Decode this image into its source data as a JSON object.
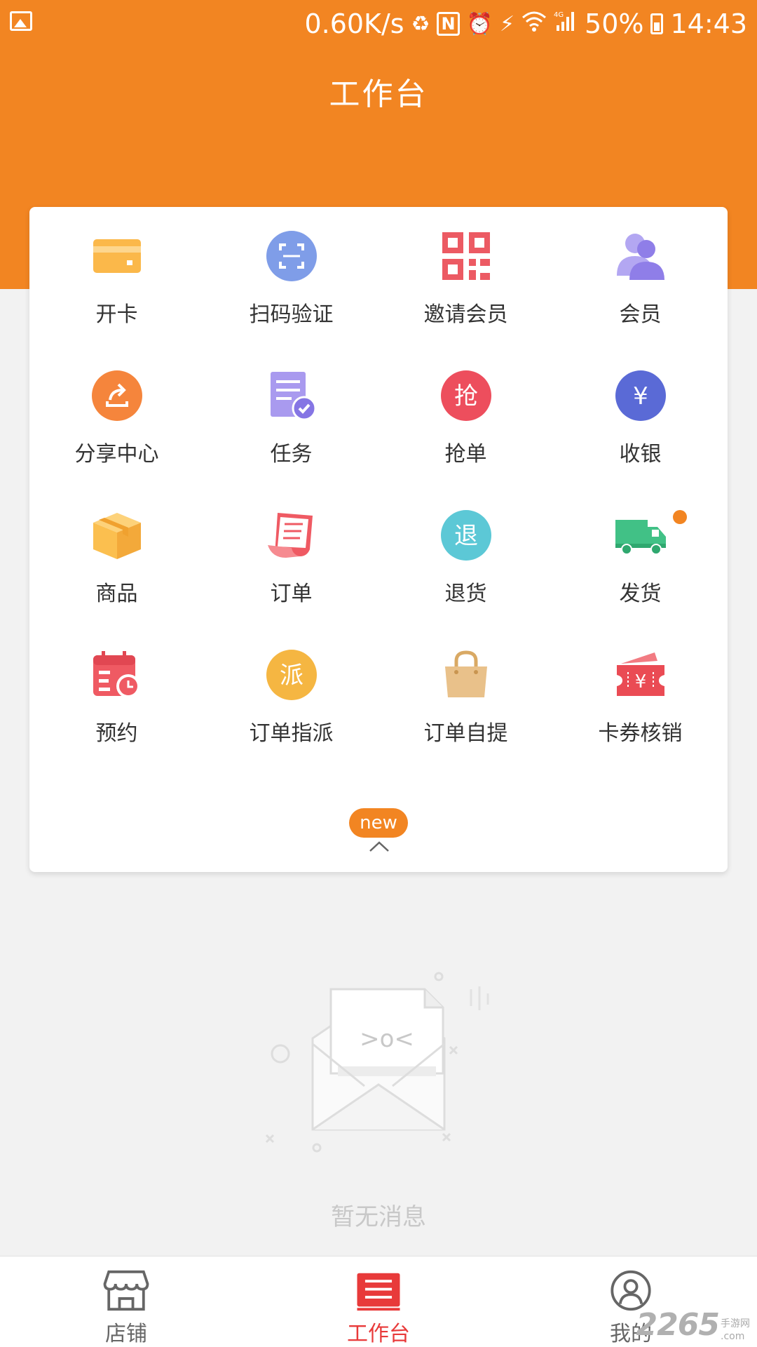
{
  "status_bar": {
    "net_speed": "0.60K/s",
    "battery_percent": "50%",
    "time": "14:43",
    "icons": [
      "gallery-icon",
      "battery-saver-icon",
      "nfc-icon",
      "alarm-icon",
      "charging-icon",
      "wifi-icon",
      "signal-4g-icon",
      "battery-icon"
    ]
  },
  "header": {
    "title": "工作台"
  },
  "grid": {
    "items": [
      {
        "label": "开卡",
        "icon": "card-icon",
        "color": "#fbb84a"
      },
      {
        "label": "扫码验证",
        "icon": "scan-icon",
        "color": "#7f9de8"
      },
      {
        "label": "邀请会员",
        "icon": "qr-code-icon",
        "color": "#ec5a63"
      },
      {
        "label": "会员",
        "icon": "members-icon",
        "color": "#9d8ded"
      },
      {
        "label": "分享中心",
        "icon": "share-icon",
        "color": "#f5853c"
      },
      {
        "label": "任务",
        "icon": "task-icon",
        "color": "#a99aef"
      },
      {
        "label": "抢单",
        "icon": "grab-order-icon",
        "color": "#ed4e5d",
        "glyph": "抢"
      },
      {
        "label": "收银",
        "icon": "cashier-icon",
        "color": "#5a6ad6",
        "glyph": "¥"
      },
      {
        "label": "商品",
        "icon": "box-icon",
        "color": "#fbbf4f"
      },
      {
        "label": "订单",
        "icon": "order-receipt-icon",
        "color": "#ef5a63"
      },
      {
        "label": "退货",
        "icon": "return-icon",
        "color": "#5cc8d6",
        "glyph": "退"
      },
      {
        "label": "发货",
        "icon": "truck-icon",
        "color": "#41c186",
        "has_dot": true
      },
      {
        "label": "预约",
        "icon": "calendar-clock-icon",
        "color": "#ef5a63"
      },
      {
        "label": "订单指派",
        "icon": "assign-icon",
        "color": "#f5b642",
        "glyph": "派"
      },
      {
        "label": "订单自提",
        "icon": "bag-icon",
        "color": "#e9c18a"
      },
      {
        "label": "卡券核销",
        "icon": "coupon-icon",
        "color": "#ea4b54",
        "glyph": "¥"
      }
    ],
    "new_badge": "new"
  },
  "empty": {
    "text": "暂无消息",
    "face": ">o<"
  },
  "tabbar": {
    "tabs": [
      {
        "label": "店铺",
        "icon": "store-icon"
      },
      {
        "label": "工作台",
        "icon": "workbench-icon"
      },
      {
        "label": "我的",
        "icon": "profile-icon"
      }
    ],
    "active_color": "#e83a3a"
  },
  "watermark": {
    "number": "2265",
    "top": "手游网",
    "bottom": ".com"
  },
  "colors": {
    "brand": "#f28522",
    "background": "#f2f2f2"
  }
}
